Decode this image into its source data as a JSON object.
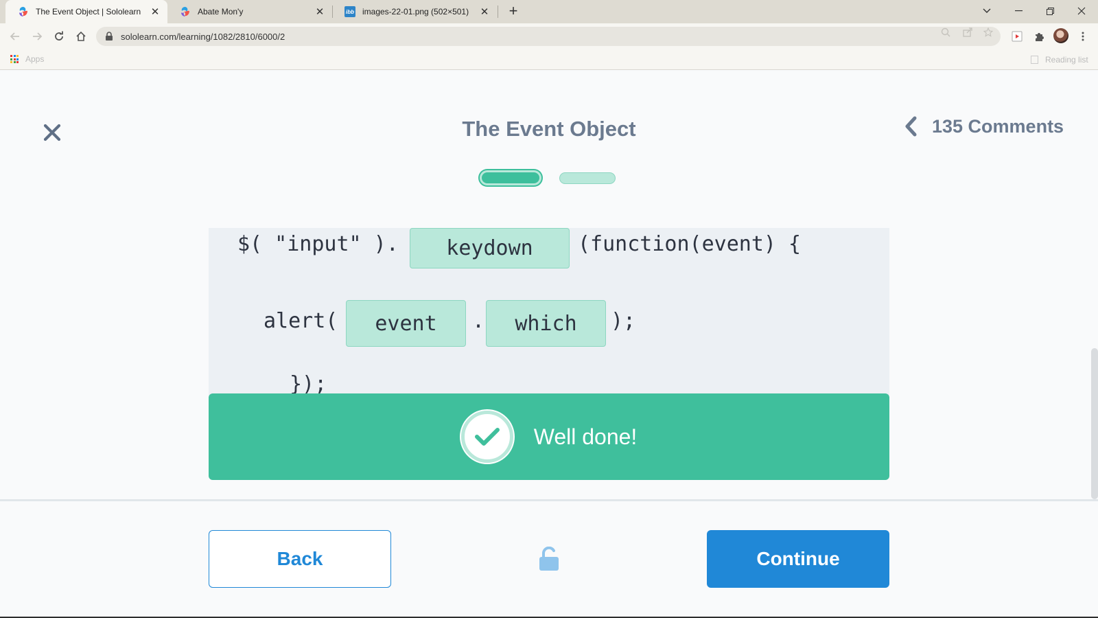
{
  "browser": {
    "tabs": [
      {
        "title": "The Event Object | Sololearn",
        "active": true,
        "favicon": "sololearn-icon"
      },
      {
        "title": "Abate Mon'y",
        "active": false,
        "favicon": "sololearn-icon"
      },
      {
        "title": "images-22-01.png (502×501)",
        "active": false,
        "favicon": "ibb-icon"
      }
    ],
    "favicon_ibb_text": "ibb",
    "new_tab_label": "+",
    "close_tab_glyph": "✕",
    "url": "sololearn.com/learning/1082/2810/6000/2",
    "bookmarks": {
      "apps_label": "Apps",
      "reading_list_label": "Reading list"
    }
  },
  "lesson": {
    "title": "The Event Object",
    "comments_label": "135 Comments",
    "progress": {
      "total_steps": 2,
      "current_step": 1
    }
  },
  "code": {
    "line1_prefix": "$( \"input\" ).",
    "line1_suffix": "(function(event) {",
    "line2_prefix": "alert(",
    "line2_dot": ".",
    "line2_suffix": ");",
    "line3_partial": "});",
    "slots": [
      "keydown",
      "event",
      "which"
    ]
  },
  "feedback": {
    "message": "Well done!"
  },
  "footer": {
    "back_label": "Back",
    "continue_label": "Continue"
  },
  "colors": {
    "accent_green": "#3fbf9c",
    "slot_green": "#b9e8da",
    "primary_blue": "#2088d7",
    "title_gray": "#6b7a8f"
  }
}
